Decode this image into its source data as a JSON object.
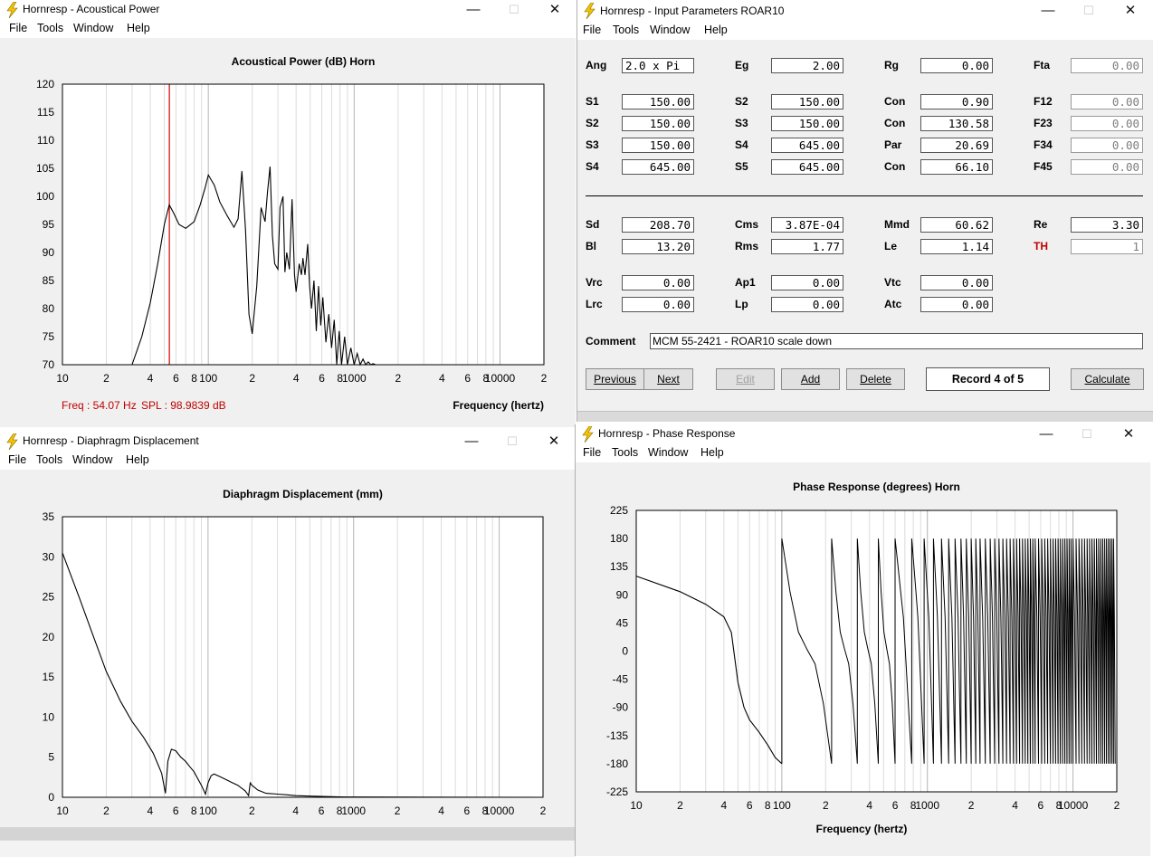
{
  "windows": {
    "acoustical": {
      "title": "Hornresp - Acoustical Power",
      "menu": [
        "File",
        "Tools",
        "Window",
        "Help"
      ],
      "chart_title": "Acoustical Power (dB)   Horn",
      "xlabel": "Frequency (hertz)",
      "status_freq": "Freq : 54.07 Hz",
      "status_spl": "SPL : 98.9839 dB"
    },
    "input": {
      "title": "Hornresp - Input Parameters   ROAR10",
      "menu": [
        "File",
        "Tools",
        "Window",
        "Help"
      ]
    },
    "displacement": {
      "title": "Hornresp - Diaphragm Displacement",
      "menu": [
        "File",
        "Tools",
        "Window",
        "Help"
      ],
      "chart_title": "Diaphragm Displacement (mm)"
    },
    "phase": {
      "title": "Hornresp - Phase Response",
      "menu": [
        "File",
        "Tools",
        "Window",
        "Help"
      ],
      "chart_title": "Phase Response (degrees)   Horn",
      "xlabel": "Frequency (hertz)"
    }
  },
  "window_buttons": {
    "minimize": "—",
    "maximize": "☐",
    "close": "✕"
  },
  "params": {
    "row1": [
      {
        "label": "Ang",
        "value": "2.0 x Pi",
        "align": "left"
      },
      {
        "label": "Eg",
        "value": "2.00"
      },
      {
        "label": "Rg",
        "value": "0.00"
      },
      {
        "label": "Fta",
        "value": "0.00",
        "disabled": true
      }
    ],
    "horn_rows": [
      [
        {
          "label": "S1",
          "value": "150.00"
        },
        {
          "label": "S2",
          "value": "150.00"
        },
        {
          "label": "Con",
          "value": "0.90"
        },
        {
          "label": "F12",
          "value": "0.00",
          "disabled": true
        }
      ],
      [
        {
          "label": "S2",
          "value": "150.00"
        },
        {
          "label": "S3",
          "value": "150.00"
        },
        {
          "label": "Con",
          "value": "130.58"
        },
        {
          "label": "F23",
          "value": "0.00",
          "disabled": true
        }
      ],
      [
        {
          "label": "S3",
          "value": "150.00"
        },
        {
          "label": "S4",
          "value": "645.00"
        },
        {
          "label": "Par",
          "value": "20.69"
        },
        {
          "label": "F34",
          "value": "0.00",
          "disabled": true
        }
      ],
      [
        {
          "label": "S4",
          "value": "645.00"
        },
        {
          "label": "S5",
          "value": "645.00"
        },
        {
          "label": "Con",
          "value": "66.10"
        },
        {
          "label": "F45",
          "value": "0.00",
          "disabled": true
        }
      ]
    ],
    "driver_rows": [
      [
        {
          "label": "Sd",
          "value": "208.70"
        },
        {
          "label": "Cms",
          "value": "3.87E-04"
        },
        {
          "label": "Mmd",
          "value": "60.62"
        },
        {
          "label": "Re",
          "value": "3.30"
        }
      ],
      [
        {
          "label": "Bl",
          "value": "13.20"
        },
        {
          "label": "Rms",
          "value": "1.77"
        },
        {
          "label": "Le",
          "value": "1.14"
        },
        {
          "label": "TH",
          "value": "1",
          "disabled": true,
          "red": true
        }
      ]
    ],
    "chamber_rows": [
      [
        {
          "label": "Vrc",
          "value": "0.00"
        },
        {
          "label": "Ap1",
          "value": "0.00"
        },
        {
          "label": "Vtc",
          "value": "0.00"
        }
      ],
      [
        {
          "label": "Lrc",
          "value": "0.00"
        },
        {
          "label": "Lp",
          "value": "0.00"
        },
        {
          "label": "Atc",
          "value": "0.00"
        }
      ]
    ],
    "comment_label": "Comment",
    "comment_value": "MCM 55-2421 - ROAR10 scale down",
    "buttons": {
      "previous": "Previous",
      "next": "Next",
      "edit": "Edit",
      "add": "Add",
      "delete": "Delete",
      "record": "Record 4 of 5",
      "calculate": "Calculate"
    }
  },
  "chart_data": [
    {
      "type": "line",
      "title": "Acoustical Power (dB)   Horn",
      "xlabel": "Frequency (hertz)",
      "xscale": "log",
      "xlim": [
        10,
        20000
      ],
      "ylim": [
        70,
        120
      ],
      "yticks": [
        70,
        75,
        80,
        85,
        90,
        95,
        100,
        105,
        110,
        115,
        120
      ],
      "xtick_labels": [
        "10",
        "2",
        "4",
        "6",
        "8",
        "100",
        "2",
        "4",
        "6",
        "8",
        "1000",
        "2",
        "4",
        "6",
        "8",
        "10000",
        "2"
      ],
      "cursor_x": 54.07,
      "x": [
        30,
        35,
        40,
        45,
        50,
        54,
        58,
        63,
        70,
        80,
        88,
        95,
        100,
        110,
        120,
        135,
        150,
        160,
        170,
        180,
        190,
        200,
        215,
        230,
        245,
        255,
        265,
        275,
        285,
        300,
        310,
        325,
        335,
        345,
        360,
        375,
        390,
        400,
        420,
        435,
        445,
        460,
        480,
        495,
        510,
        530,
        550,
        570,
        590,
        610,
        640,
        670,
        700,
        730,
        760,
        790,
        820,
        860,
        900,
        950,
        1000,
        1050,
        1100,
        1150,
        1200,
        1250,
        1300,
        1350,
        1400,
        1450,
        1500,
        1550,
        1600,
        1700
      ],
      "y": [
        70,
        75,
        81,
        88,
        95,
        98.5,
        97,
        95,
        94.3,
        95.5,
        98.5,
        101.5,
        103.8,
        102,
        99,
        96.5,
        94.5,
        96,
        104.5,
        94,
        79,
        75.5,
        84,
        98,
        95.5,
        101,
        105.3,
        93,
        88,
        87,
        98,
        100,
        86.5,
        90,
        87,
        99.5,
        86,
        83,
        88,
        86,
        89,
        86,
        91.5,
        84,
        80,
        85,
        76,
        84,
        77,
        82,
        74,
        79,
        73,
        78,
        70,
        76,
        70,
        75,
        70,
        73,
        70,
        72,
        70,
        71,
        70,
        70.5,
        70,
        70.2,
        70,
        70,
        70,
        70,
        70,
        70
      ]
    },
    {
      "type": "line",
      "title": "Diaphragm Displacement (mm)",
      "xscale": "log",
      "xlim": [
        10,
        20000
      ],
      "ylim": [
        0,
        35
      ],
      "yticks": [
        0,
        5,
        10,
        15,
        20,
        25,
        30,
        35
      ],
      "xtick_labels": [
        "10",
        "2",
        "4",
        "6",
        "8",
        "100",
        "2",
        "4",
        "6",
        "8",
        "1000",
        "2",
        "4",
        "6",
        "8",
        "10000",
        "2"
      ],
      "x": [
        10,
        13,
        16,
        20,
        25,
        30,
        36,
        42,
        48,
        51,
        53,
        56,
        60,
        65,
        70,
        75,
        80,
        90,
        96,
        100,
        105,
        110,
        120,
        140,
        160,
        180,
        190,
        195,
        200,
        220,
        250,
        300,
        350,
        400,
        500,
        600,
        800,
        1000,
        2000,
        5000,
        20000
      ],
      "y": [
        30.5,
        25,
        20.5,
        15.7,
        12,
        9.5,
        7.5,
        5.5,
        3,
        0.5,
        4.5,
        6,
        5.8,
        5,
        4.5,
        3.8,
        3.2,
        1.5,
        0.4,
        1.8,
        2.7,
        2.9,
        2.6,
        2,
        1.5,
        0.8,
        0.2,
        1.8,
        1.5,
        0.9,
        0.5,
        0.4,
        0.3,
        0.2,
        0.15,
        0.1,
        0.05,
        0.03,
        0.02,
        0.01,
        0
      ]
    },
    {
      "type": "line",
      "title": "Phase Response (degrees)   Horn",
      "xlabel": "Frequency (hertz)",
      "xscale": "log",
      "xlim": [
        10,
        20000
      ],
      "ylim": [
        -225,
        225
      ],
      "yticks": [
        -225,
        -180,
        -135,
        -90,
        -45,
        0,
        45,
        90,
        135,
        180,
        225
      ],
      "xtick_labels": [
        "10",
        "2",
        "4",
        "6",
        "8",
        "100",
        "2",
        "4",
        "6",
        "8",
        "1000",
        "2",
        "4",
        "6",
        "8",
        "10000",
        "2"
      ],
      "phase_wraps_x": [
        100,
        220,
        330,
        460,
        600,
        780,
        950,
        1100,
        1250,
        1400,
        1550,
        1700,
        1850,
        2000,
        2150,
        2300,
        2500,
        2700,
        2900,
        3100,
        3300,
        3500,
        3700,
        3900,
        4100,
        4300,
        4500,
        4700,
        4900,
        5100,
        5300,
        5500,
        5800,
        6100,
        6400,
        6700,
        7000,
        7300,
        7600,
        7900,
        8200,
        8500,
        8800,
        9100,
        9400,
        9700,
        10000,
        10500,
        11000,
        11500,
        12000,
        12500,
        13000,
        13500,
        14000,
        14500,
        15000,
        15500,
        16000,
        16500,
        17000,
        17500,
        18000,
        18500,
        19000,
        19500
      ],
      "x": [
        10,
        20,
        30,
        40,
        45,
        50,
        55,
        60,
        70,
        80,
        90,
        100
      ],
      "y": [
        120,
        95,
        75,
        55,
        30,
        -50,
        -90,
        -110,
        -130,
        -150,
        -170,
        -180
      ]
    }
  ]
}
